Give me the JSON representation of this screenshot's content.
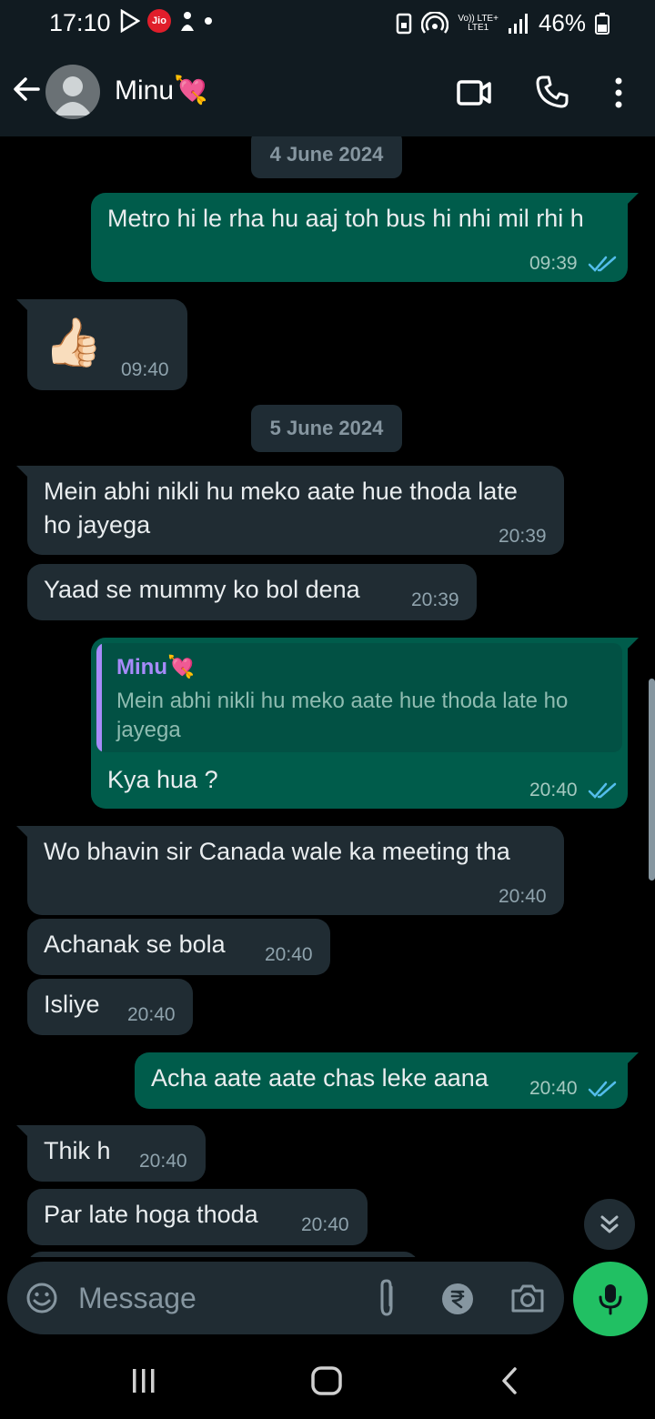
{
  "status_bar": {
    "time": "17:10",
    "carrier_badge": "Jio",
    "battery": "46%",
    "network_top": "Vo)) LTE+",
    "network_bottom": "LTE1"
  },
  "header": {
    "contact_name": "Minu💘"
  },
  "chat": {
    "dates": [
      "4 June 2024",
      "5 June 2024"
    ],
    "messages": [
      {
        "dir": "out",
        "text": "Metro hi le rha hu aaj toh bus hi nhi mil rhi h",
        "time": "09:39"
      },
      {
        "dir": "in",
        "text": "👍🏻",
        "time": "09:40"
      },
      {
        "dir": "in",
        "text": "Mein abhi nikli hu meko aate hue thoda late ho jayega",
        "time": "20:39"
      },
      {
        "dir": "in",
        "text": "Yaad se mummy ko bol dena",
        "time": "20:39"
      },
      {
        "dir": "out",
        "reply_to_name": "Minu💘",
        "reply_to_text": "Mein abhi nikli hu meko aate hue thoda late ho jayega",
        "text": "Kya hua ?",
        "time": "20:40"
      },
      {
        "dir": "in",
        "text": "Wo bhavin sir Canada wale ka meeting tha",
        "time": "20:40"
      },
      {
        "dir": "in",
        "text": "Achanak se bola",
        "time": "20:40"
      },
      {
        "dir": "in",
        "text": "Isliye",
        "time": "20:40"
      },
      {
        "dir": "out",
        "text": "Acha aate aate chas leke aana",
        "time": "20:40"
      },
      {
        "dir": "in",
        "text": "Thik h",
        "time": "20:40"
      },
      {
        "dir": "in",
        "text": "Par late hoga thoda",
        "time": "20:40"
      }
    ]
  },
  "composer": {
    "placeholder": "Message"
  },
  "colors": {
    "incoming": "#202c33",
    "outgoing": "#005c4b",
    "accent": "#21c063",
    "read_ticks": "#53bdeb"
  }
}
